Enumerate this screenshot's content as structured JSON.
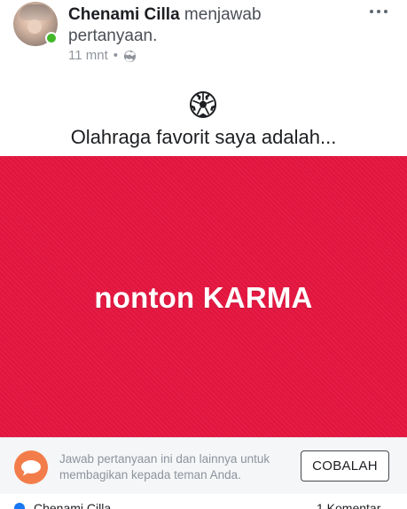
{
  "post": {
    "author": "Chenami Cilla",
    "action_line_1": " menjawab",
    "action_line_2": "pertanyaan.",
    "time": "11 mnt",
    "separator": "•",
    "privacy_icon": "globe-icon"
  },
  "question": {
    "emoji_icon": "soccer-ball-icon",
    "text": "Olahraga favorit saya adalah..."
  },
  "answer": {
    "text_prefix": "nonton ",
    "text_emphasis": "KARMA",
    "background_color": "#e5153f"
  },
  "promo": {
    "icon": "chat-bubble-icon",
    "line_1": "Jawab pertanyaan ini dan lainnya untuk",
    "line_2": "membagikan kepada teman Anda.",
    "button_label": "COBALAH"
  },
  "footer": {
    "name_partial": "Chenami Cilla",
    "comments_partial": "1 Komentar"
  },
  "colors": {
    "online": "#42b72a",
    "promo_icon": "#f37d4a",
    "text_muted": "#90949c"
  }
}
